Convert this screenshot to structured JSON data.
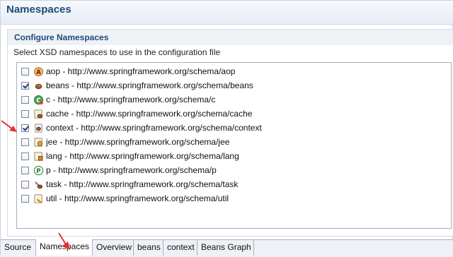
{
  "header": {
    "title": "Namespaces"
  },
  "section": {
    "title": "Configure Namespaces",
    "description": "Select XSD namespaces to use in the configuration file"
  },
  "namespaces": [
    {
      "label": "aop - http://www.springframework.org/schema/aop",
      "checked": false,
      "icon": "aop-icon"
    },
    {
      "label": "beans - http://www.springframework.org/schema/beans",
      "checked": true,
      "icon": "beans-icon"
    },
    {
      "label": "c - http://www.springframework.org/schema/c",
      "checked": false,
      "icon": "c-namespace-icon"
    },
    {
      "label": "cache - http://www.springframework.org/schema/cache",
      "checked": false,
      "icon": "cache-icon"
    },
    {
      "label": "context - http://www.springframework.org/schema/context",
      "checked": true,
      "icon": "context-icon"
    },
    {
      "label": "jee - http://www.springframework.org/schema/jee",
      "checked": false,
      "icon": "jee-icon"
    },
    {
      "label": "lang - http://www.springframework.org/schema/lang",
      "checked": false,
      "icon": "lang-icon"
    },
    {
      "label": "p - http://www.springframework.org/schema/p",
      "checked": false,
      "icon": "p-namespace-icon"
    },
    {
      "label": "task - http://www.springframework.org/schema/task",
      "checked": false,
      "icon": "task-icon"
    },
    {
      "label": "util - http://www.springframework.org/schema/util",
      "checked": false,
      "icon": "util-icon"
    }
  ],
  "tabs": [
    {
      "label": "Source",
      "active": false
    },
    {
      "label": "Namespaces",
      "active": true
    },
    {
      "label": "Overview",
      "active": false
    },
    {
      "label": "beans",
      "active": false
    },
    {
      "label": "context",
      "active": false
    },
    {
      "label": "Beans Graph",
      "active": false
    }
  ],
  "colors": {
    "title": "#1e4a78",
    "annotation_arrow": "#e8312f",
    "checkmark": "#1a3a9c"
  }
}
